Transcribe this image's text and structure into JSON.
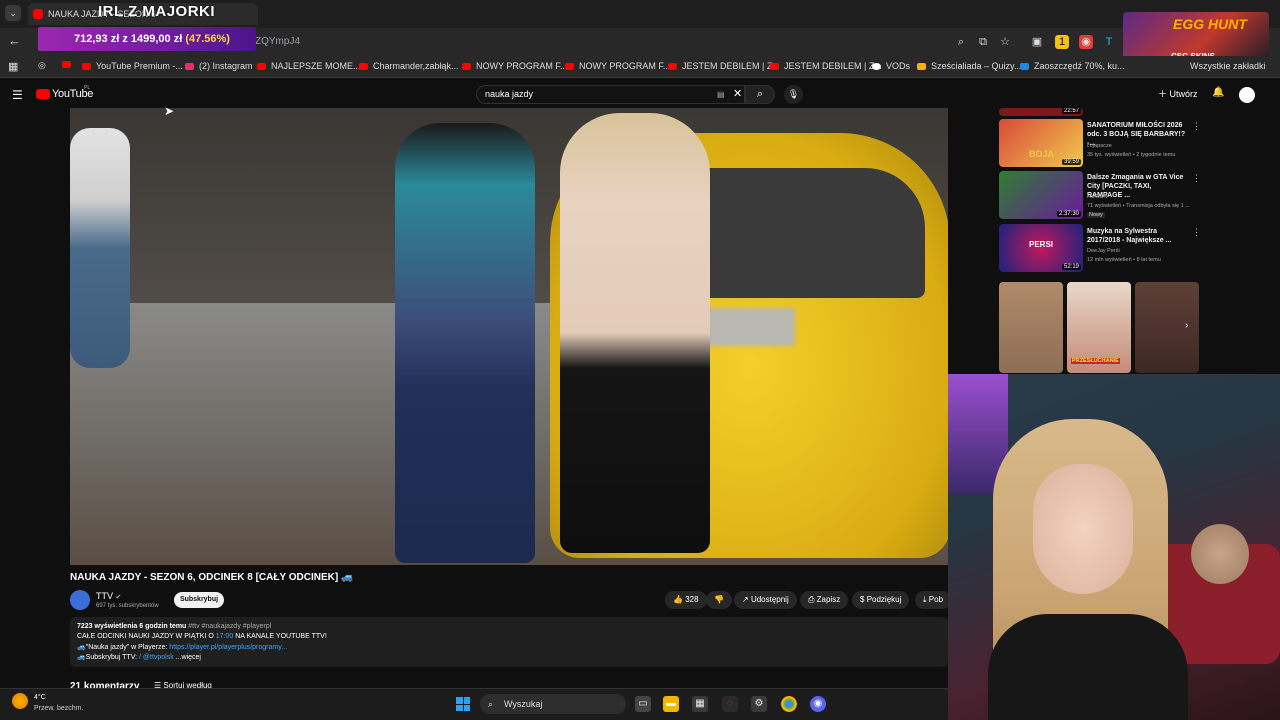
{
  "browser": {
    "tab_title": "NAUKA JAZDY - SEZON 6",
    "overlay_title": "IRL Z MAJORKI",
    "url_fragment": "ZQYmpJ4",
    "goal": {
      "current": "712,93 zł",
      "sep": "z",
      "target": "1499,00 zł",
      "percent": "(47.56%)"
    },
    "bookmarks": [
      "YouTube Premium -...",
      "(2) Instagram",
      "NAJLEPSZE MOME...",
      "Charmander,zabłąk...",
      "NOWY PROGRAM F...",
      "NOWY PROGRAM F...",
      "JESTEM DEBILEM | Z...",
      "JESTEM DEBILEM | Z...",
      "VODs",
      "Sześcialiada – Quizy...",
      "Zaoszczędź 70%, ku...",
      "Wszystkie zakładki"
    ]
  },
  "ad": {
    "headline": "EGG HUNT",
    "brand": "CSG SKINS"
  },
  "youtube": {
    "logo": "YouTube",
    "region": "PL",
    "search_query": "nauka jazdy",
    "create_label": "Utwórz",
    "video": {
      "title": "NAUKA JAZDY - SEZON 6, ODCINEK 8 [CAŁY ODCINEK] 🚙",
      "channel": "TTV",
      "subscribers": "697 tys. subskrybentów",
      "subscribe_label": "Subskrybuj",
      "likes": "328",
      "share_label": "Udostępnij",
      "save_label": "Zapisz",
      "thanks_label": "Podziękuj",
      "download_label": "Pob",
      "desc_line1_bold": "7223 wyświetlenia  6 godzin temu",
      "desc_line1_tags": "#ttv #naukajazdy #playerpl",
      "desc_line2a": "CAŁE ODCINKI NAUKI JAZDY W PIĄTKI O ",
      "desc_line2_time": "17:00",
      "desc_line2b": " NA KANALE YOUTUBE TTV!",
      "desc_line3a": "🚙\"Nauka jazdy\" w Playerze: ",
      "desc_line3_link": "https://player.pl/playerplus/programy...",
      "desc_line4a": "🚙Subskrybuj TTV: ",
      "desc_line4_link": "/ @ttvpolsk",
      "desc_more": "...więcej",
      "comments": "21 komentarzy",
      "sort_label": "Sortuj według"
    },
    "recommendations": [
      {
        "title": "",
        "channel": "",
        "meta": "",
        "duration": "22:57"
      },
      {
        "title": "SANATORIUM MIŁOŚCI 2026 odc. 3 BOJĄ SIĘ BARBARY!? -...",
        "channel": "cojapacze",
        "meta": "35 tys. wyświetleń • 2 tygodnie temu",
        "duration": "39:59",
        "thumb_text": "BOJA"
      },
      {
        "title": "Dalsze Zmagania w GTA Vice City [PACZKI, TAXI, RAMPAGE ...",
        "channel": "HUGON",
        "meta": "71 wyświetleń • Transmisja odbyła się 1 ...",
        "badge": "Nowy",
        "duration": "2:37:30"
      },
      {
        "title": "Muzyka na Sylwestra 2017/2018 - Największe ...",
        "channel": "DeeJay Perśi",
        "meta": "12 mln wyświetleń • 8 lat temu",
        "duration": "52:19",
        "thumb_text": "PERSI"
      }
    ],
    "shorts_label": "PRZESŁUCHANIE"
  },
  "taskbar": {
    "temperature": "4°C",
    "weather": "Przew. bezchm.",
    "search_placeholder": "Wyszukaj"
  }
}
